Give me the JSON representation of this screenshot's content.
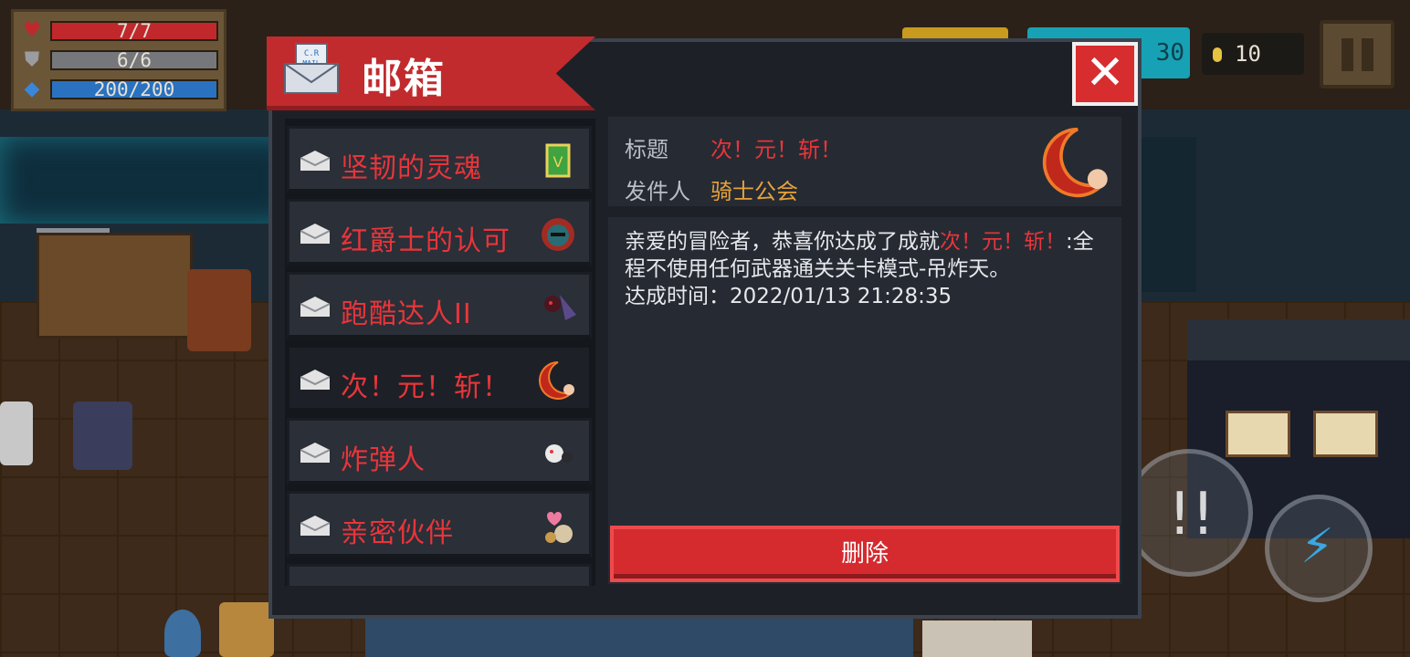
{
  "hud": {
    "hp": "7/7",
    "armor": "6/6",
    "energy": "200/200",
    "gems": "30",
    "coins": "10",
    "hp_icon": "heart-icon",
    "armor_icon": "shield-icon",
    "energy_icon": "diamond-icon",
    "pause_icon": "pause-icon"
  },
  "mailbox": {
    "title": "邮箱",
    "icon_text": "C.R\nMAIL",
    "close_icon": "close-icon",
    "items": [
      {
        "label": "坚韧的灵魂",
        "thumb": "card-icon"
      },
      {
        "label": "红爵士的认可",
        "thumb": "knight-helmet-icon"
      },
      {
        "label": "跑酷达人II",
        "thumb": "ninja-icon"
      },
      {
        "label": "次！元！斩！",
        "thumb": "crescent-blade-icon"
      },
      {
        "label": "炸弹人",
        "thumb": "bomber-icon"
      },
      {
        "label": "亲密伙伴",
        "thumb": "pet-heart-icon"
      }
    ],
    "detail": {
      "title_label": "标题",
      "title_value": "次！元！斩！",
      "sender_label": "发件人",
      "sender_value": "骑士公会",
      "body_prefix": "亲爱的冒险者，恭喜你达成了成就",
      "body_highlight": "次！元！斩！",
      "body_suffix": ":全程不使用任何武器通关关卡模式-吊炸天。",
      "time_line": "达成时间：2022/01/13 21:28:35",
      "delete_label": "删除"
    }
  },
  "colors": {
    "accent_red": "#e8353a",
    "sender_gold": "#e6a23c",
    "panel": "#262b33"
  }
}
